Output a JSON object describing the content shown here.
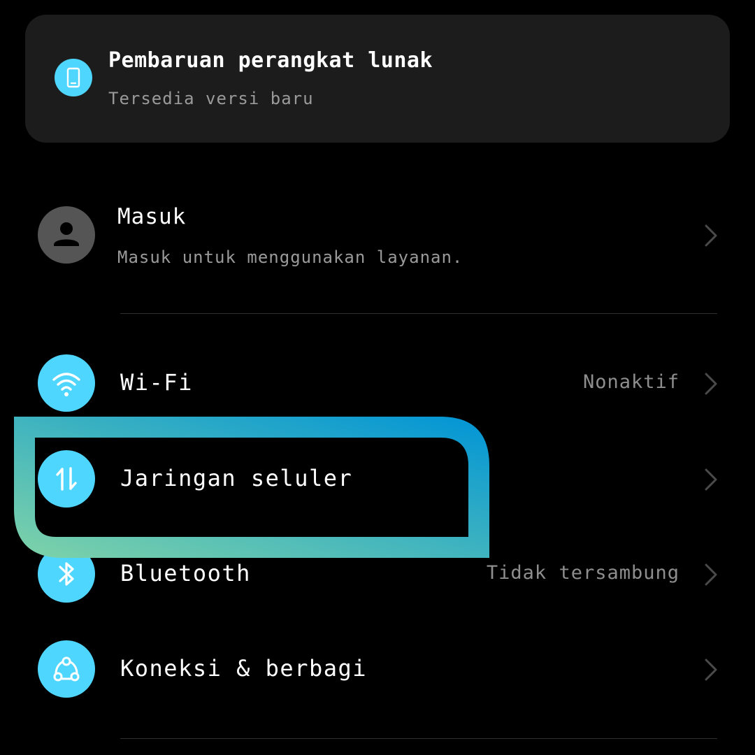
{
  "update_card": {
    "title": "Pembaruan perangkat lunak",
    "subtitle": "Tersedia versi baru",
    "icon": "phone-icon"
  },
  "account": {
    "title": "Masuk",
    "subtitle": "Masuk untuk menggunakan layanan.",
    "icon": "person-icon"
  },
  "settings": [
    {
      "label": "Wi-Fi",
      "value": "Nonaktif",
      "icon": "wifi-icon"
    },
    {
      "label": "Jaringan seluler",
      "value": "",
      "icon": "mobile-data-icon"
    },
    {
      "label": "Bluetooth",
      "value": "Tidak tersambung",
      "icon": "bluetooth-icon"
    },
    {
      "label": "Koneksi & berbagi",
      "value": "",
      "icon": "connection-sharing-icon"
    }
  ],
  "colors": {
    "accent": "#4fd6ff",
    "card_background": "#1c1c1c",
    "highlight_gradient_start": "#7fd3a8",
    "highlight_gradient_end": "#0094d6"
  }
}
